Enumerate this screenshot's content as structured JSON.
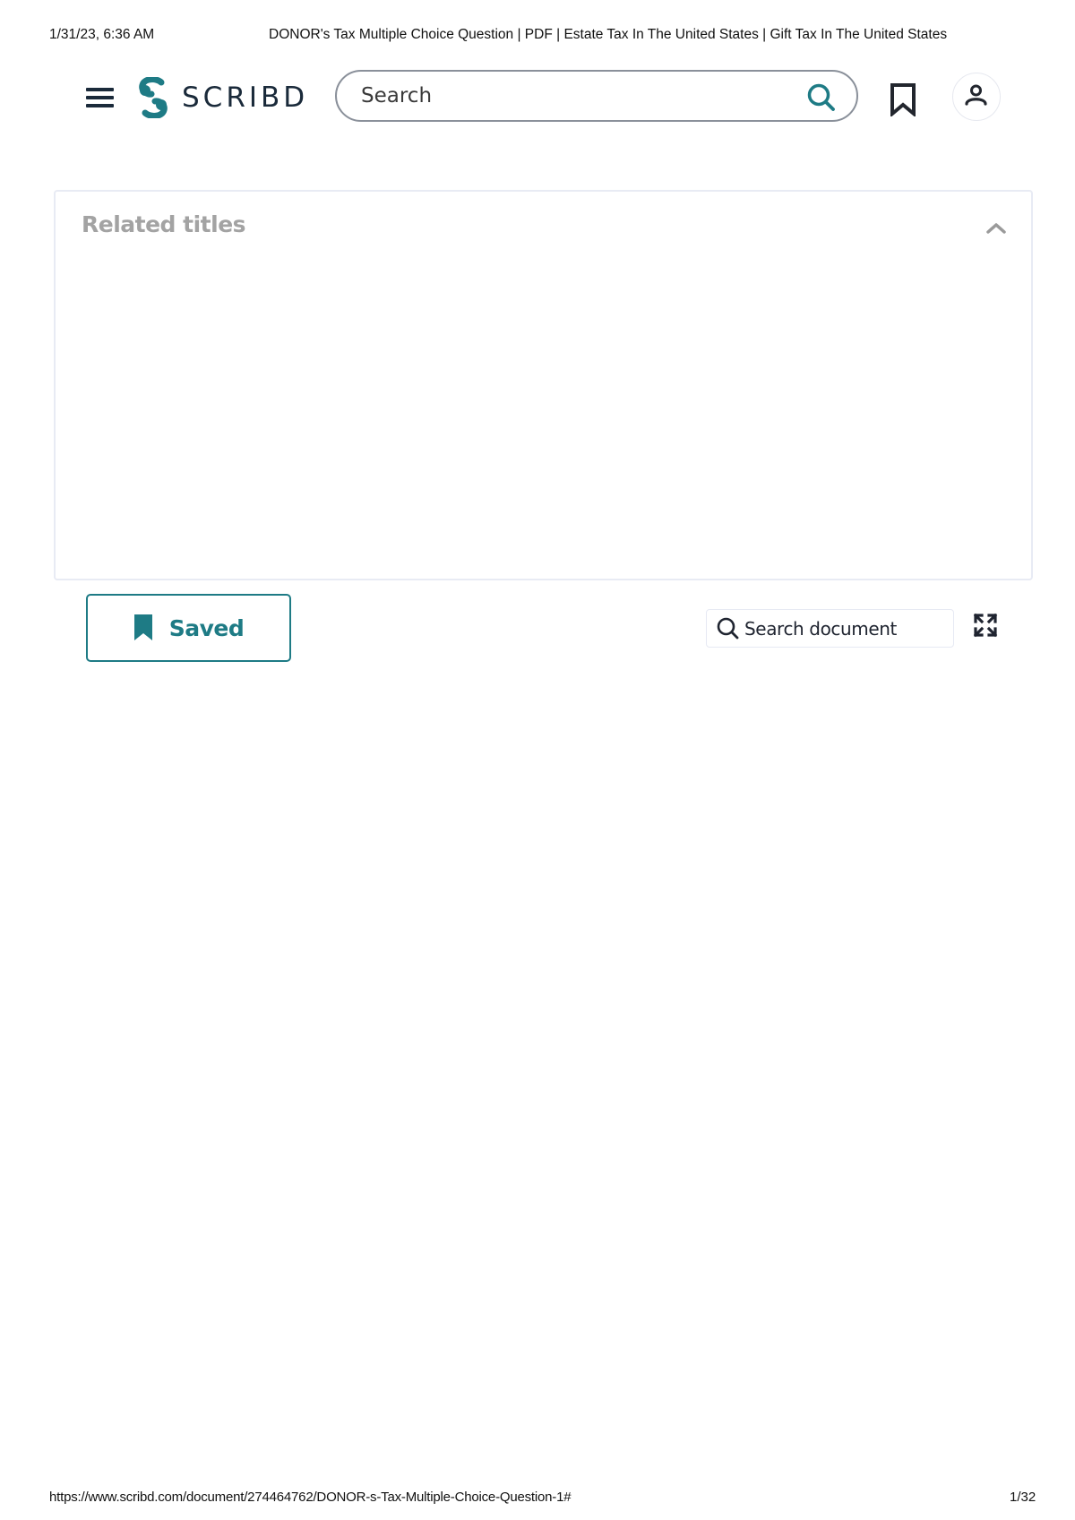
{
  "print_header": {
    "date": "1/31/23, 6:36 AM",
    "title": "DONOR's Tax Multiple Choice Question | PDF | Estate Tax In The United States | Gift Tax In The United States"
  },
  "print_footer": {
    "url": "https://www.scribd.com/document/274464762/DONOR-s-Tax-Multiple-Choice-Question-1#",
    "page": "1/32"
  },
  "topbar": {
    "menu_icon": "hamburger-menu-icon",
    "logo_text": "SCRIBD",
    "search_placeholder": "Search",
    "search_icon": "search-icon",
    "saved_icon": "bookmark-icon",
    "account_icon": "user-icon"
  },
  "related_titles": {
    "heading": "Related titles",
    "toggle_icon": "chevron-up-icon",
    "expanded": true
  },
  "document_toolbar": {
    "saved_label": "Saved",
    "saved_icon": "bookmark-filled-icon",
    "search_placeholder": "Search document",
    "search_icon": "search-icon",
    "fullscreen_icon": "expand-icon"
  },
  "colors": {
    "brand_teal": "#1e7b85",
    "text_dark": "#1a2a3a",
    "muted_gray": "#a3a3a3",
    "border_light": "#e8ebf4"
  }
}
